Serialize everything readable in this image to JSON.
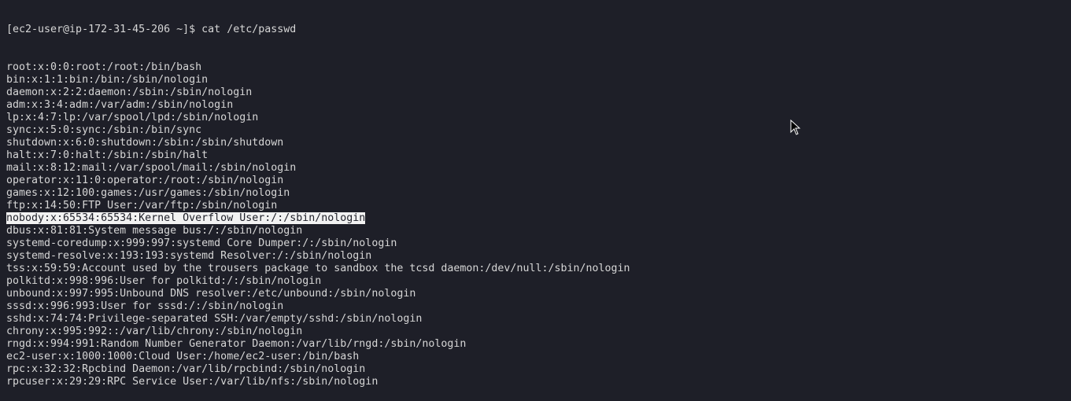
{
  "prompt": "[ec2-user@ip-172-31-45-206 ~]$ cat /etc/passwd",
  "lines": [
    "root:x:0:0:root:/root:/bin/bash",
    "bin:x:1:1:bin:/bin:/sbin/nologin",
    "daemon:x:2:2:daemon:/sbin:/sbin/nologin",
    "adm:x:3:4:adm:/var/adm:/sbin/nologin",
    "lp:x:4:7:lp:/var/spool/lpd:/sbin/nologin",
    "sync:x:5:0:sync:/sbin:/bin/sync",
    "shutdown:x:6:0:shutdown:/sbin:/sbin/shutdown",
    "halt:x:7:0:halt:/sbin:/sbin/halt",
    "mail:x:8:12:mail:/var/spool/mail:/sbin/nologin",
    "operator:x:11:0:operator:/root:/sbin/nologin",
    "games:x:12:100:games:/usr/games:/sbin/nologin",
    "ftp:x:14:50:FTP User:/var/ftp:/sbin/nologin",
    "nobody:x:65534:65534:Kernel Overflow User:/:/sbin/nologin",
    "dbus:x:81:81:System message bus:/:/sbin/nologin",
    "systemd-coredump:x:999:997:systemd Core Dumper:/:/sbin/nologin",
    "systemd-resolve:x:193:193:systemd Resolver:/:/sbin/nologin",
    "tss:x:59:59:Account used by the trousers package to sandbox the tcsd daemon:/dev/null:/sbin/nologin",
    "polkitd:x:998:996:User for polkitd:/:/sbin/nologin",
    "unbound:x:997:995:Unbound DNS resolver:/etc/unbound:/sbin/nologin",
    "sssd:x:996:993:User for sssd:/:/sbin/nologin",
    "sshd:x:74:74:Privilege-separated SSH:/var/empty/sshd:/sbin/nologin",
    "chrony:x:995:992::/var/lib/chrony:/sbin/nologin",
    "rngd:x:994:991:Random Number Generator Daemon:/var/lib/rngd:/sbin/nologin",
    "ec2-user:x:1000:1000:Cloud User:/home/ec2-user:/bin/bash",
    "rpc:x:32:32:Rpcbind Daemon:/var/lib/rpcbind:/sbin/nologin",
    "rpcuser:x:29:29:RPC Service User:/var/lib/nfs:/sbin/nologin"
  ],
  "selected_line_index": 12,
  "colors": {
    "background": "#1e1f28",
    "text": "#d6d6d6",
    "selection": "#f2f2f2"
  }
}
